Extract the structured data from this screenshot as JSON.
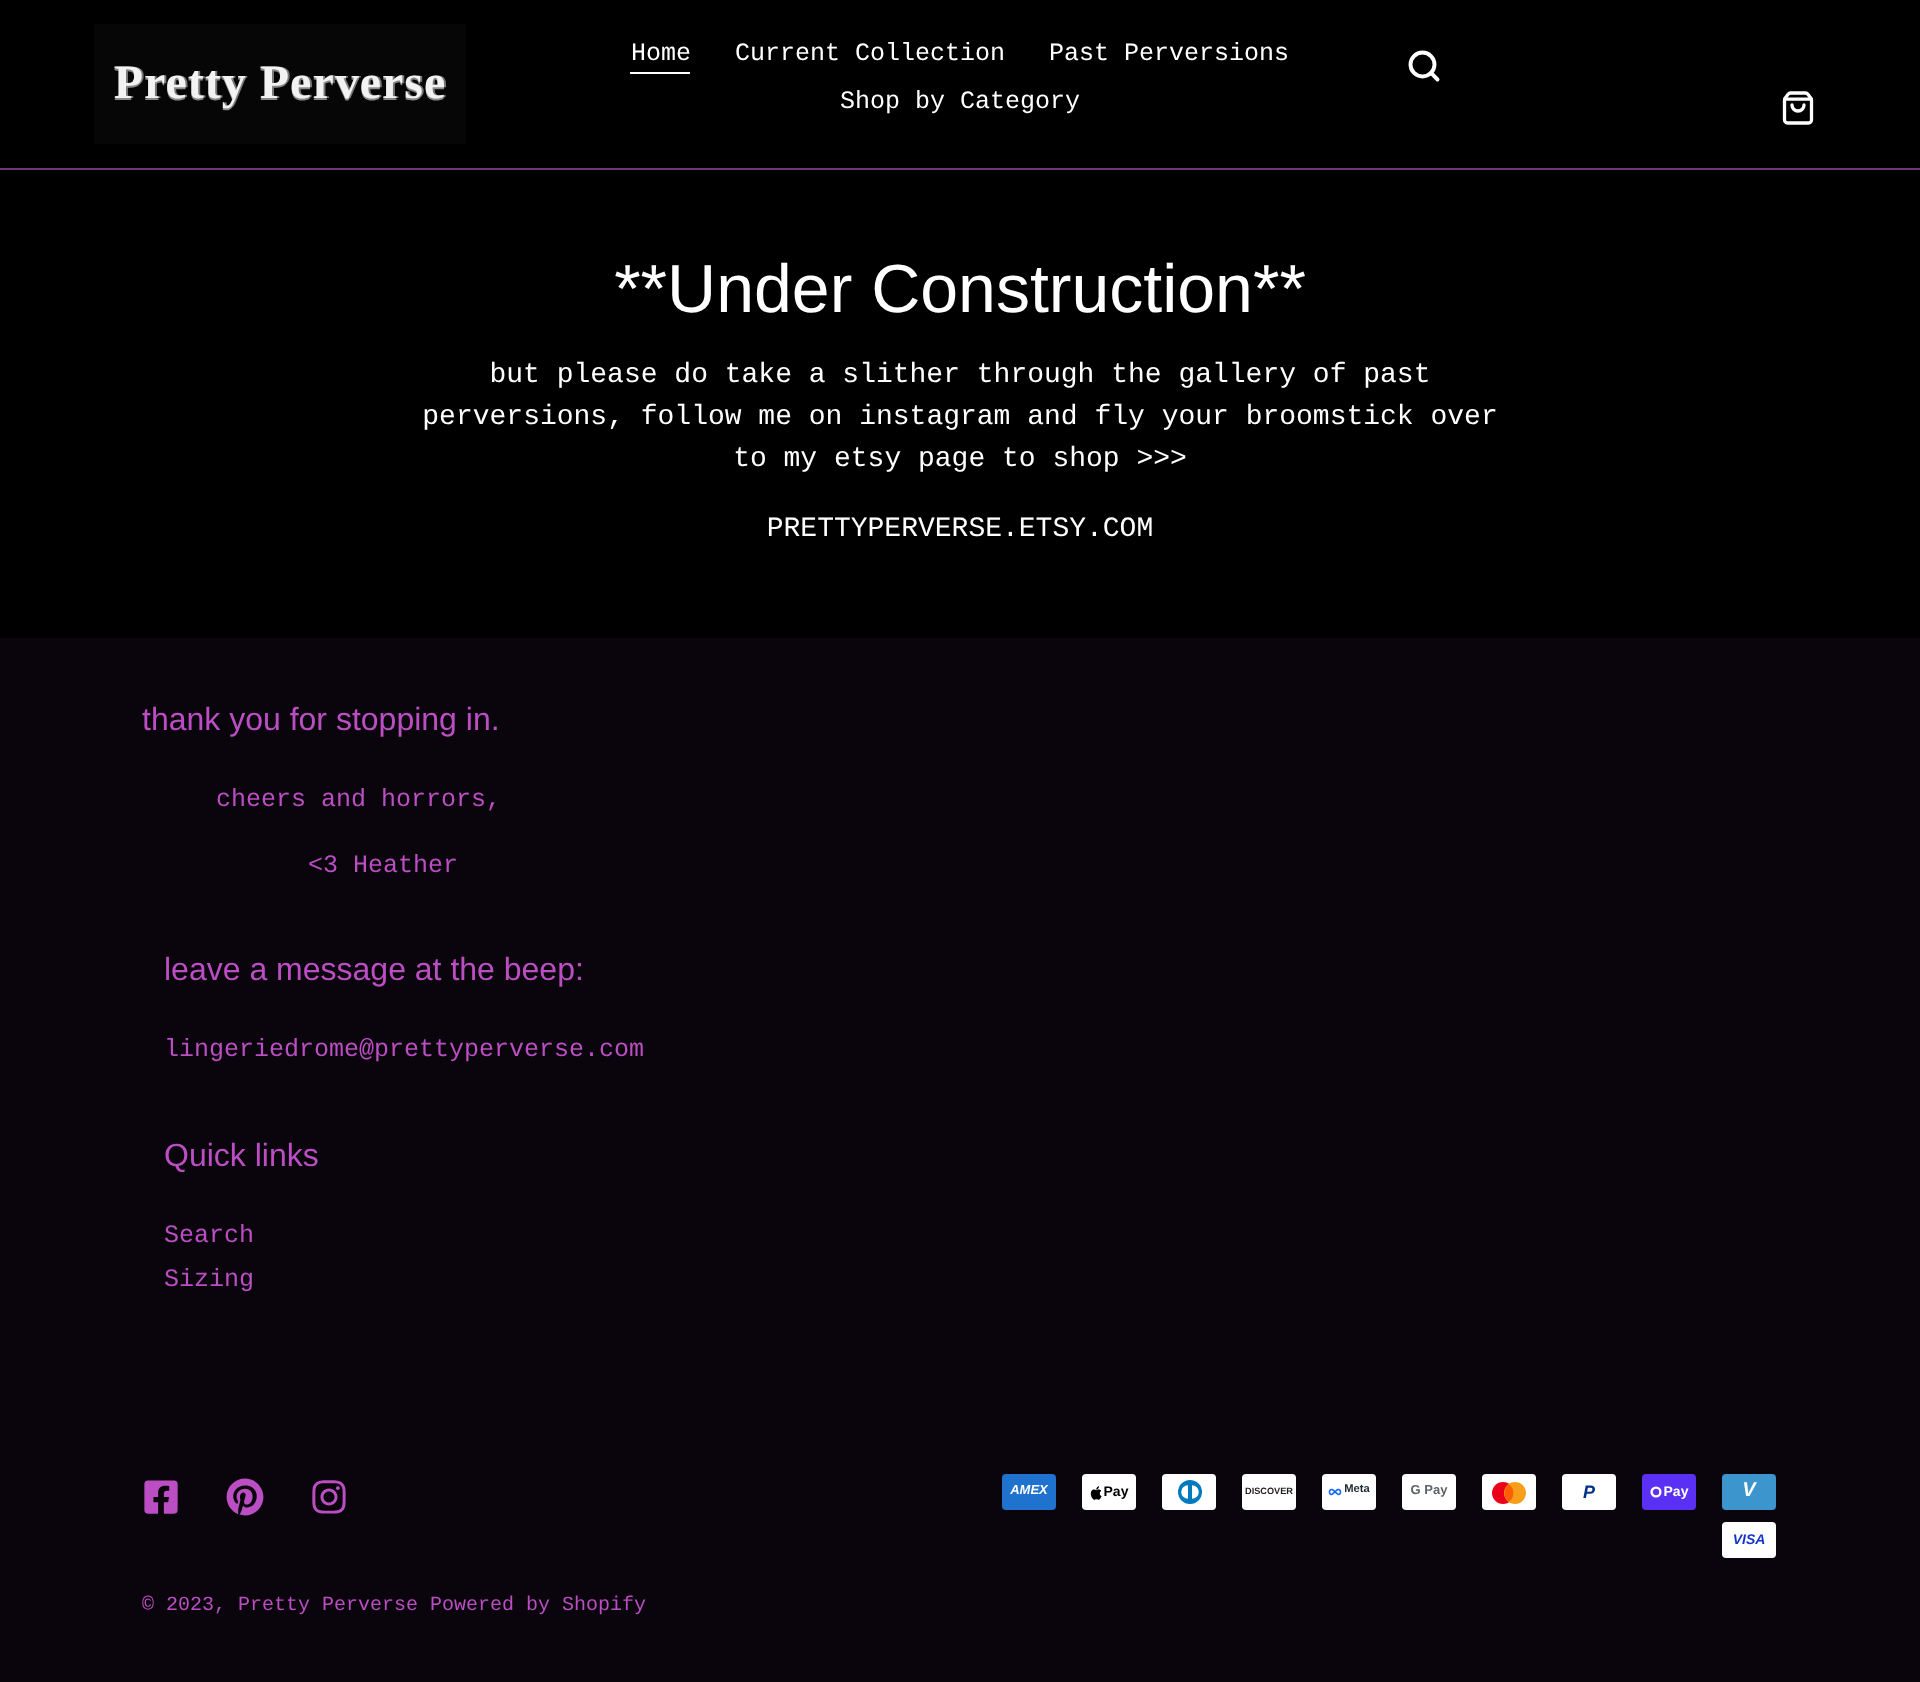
{
  "header": {
    "logo": "Pretty Perverse",
    "nav": [
      {
        "label": "Home",
        "selected": true
      },
      {
        "label": "Current Collection",
        "selected": false
      },
      {
        "label": "Past Perversions",
        "selected": false
      },
      {
        "label": "Shop by Category",
        "selected": false
      }
    ]
  },
  "hero": {
    "title": "**Under Construction**",
    "text": "but please do take a slither through the gallery of past perversions, follow me on instagram and fly your broomstick over to my etsy page to shop >>>",
    "link": "PRETTYPERVERSE.ETSY.COM"
  },
  "footer": {
    "note": [
      {
        "kind": "lead",
        "text": "thank you for stopping in."
      },
      {
        "kind": "signoff",
        "text": "cheers and horrors,"
      },
      {
        "kind": "signature",
        "text": "<3 Heather"
      }
    ],
    "contact": {
      "title": "leave a message at the beep:",
      "email": "lingeriedrome@prettyperverse.com"
    },
    "quick_links": {
      "title": "Quick links",
      "links": [
        "Search",
        "Sizing"
      ]
    },
    "payments": [
      {
        "kind": "amex",
        "label": "AMEX"
      },
      {
        "kind": "apple_pay",
        "label": "Pay"
      },
      {
        "kind": "diners"
      },
      {
        "kind": "discover",
        "label": "DISCOVER"
      },
      {
        "kind": "meta_pay",
        "label": "Meta"
      },
      {
        "kind": "google_pay",
        "label": "G Pay"
      },
      {
        "kind": "mastercard"
      },
      {
        "kind": "paypal",
        "label": "P"
      },
      {
        "kind": "shop_pay",
        "label": "Pay"
      },
      {
        "kind": "venmo",
        "label": "V"
      },
      {
        "kind": "visa",
        "label": "VISA"
      }
    ],
    "copyright": {
      "text": "© 2023,",
      "site": "Pretty Perverse",
      "powered": "Powered by Shopify"
    }
  }
}
